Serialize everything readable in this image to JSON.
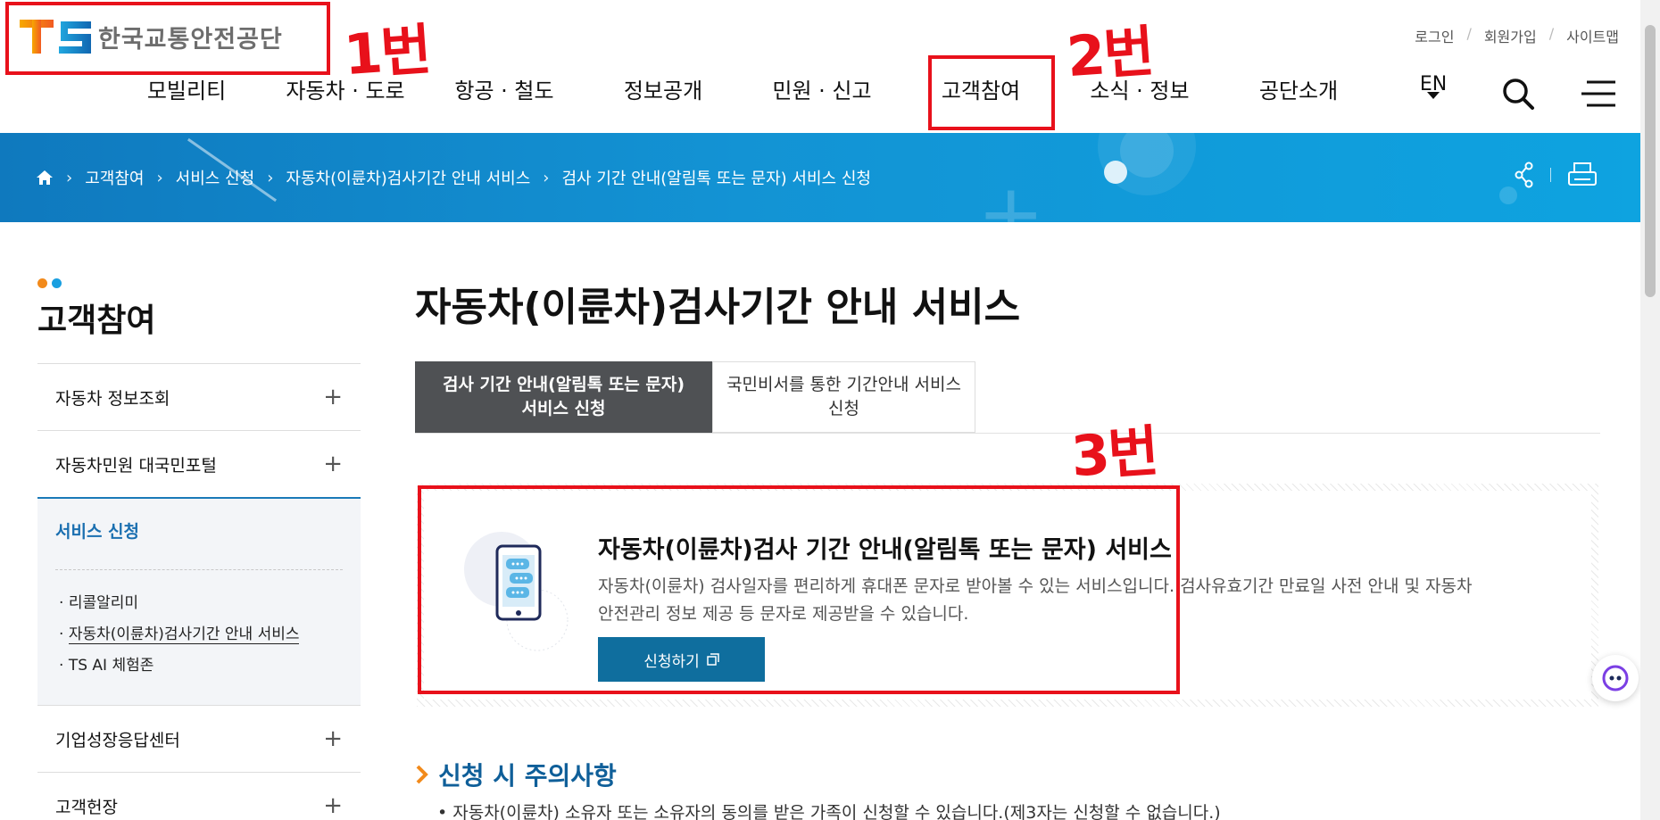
{
  "header": {
    "logo_letters": "TS",
    "logo_text": "한국교통안전공단",
    "util": [
      "로그인",
      "회원가입",
      "사이트맵"
    ],
    "gnb": [
      "모빌리티",
      "자동차 · 도로",
      "항공 · 철도",
      "정보공개",
      "민원 · 신고",
      "고객참여",
      "소식 · 정보",
      "공단소개"
    ],
    "lang": "EN"
  },
  "breadcrumb": [
    "고객참여",
    "서비스 신청",
    "자동차(이륜차)검사기간 안내 서비스",
    "검사 기간 안내(알림톡 또는 문자) 서비스 신청"
  ],
  "sidebar": {
    "title": "고객참여",
    "items": [
      {
        "label": "자동차 정보조회"
      },
      {
        "label": "자동차민원 대국민포털"
      },
      {
        "label": "서비스 신청"
      },
      {
        "label": "기업성장응답센터"
      },
      {
        "label": "고객헌장"
      }
    ],
    "sub_items": [
      "리콜알리미",
      "자동차(이륜차)검사기간 안내 서비스",
      "TS AI 체험존"
    ],
    "sub_bullet": "·"
  },
  "content": {
    "title": "자동차(이륜차)검사기간 안내 서비스",
    "tabs": [
      {
        "line1": "검사 기간 안내(알림톡 또는 문자)",
        "line2": "서비스 신청"
      },
      {
        "line1": "국민비서를 통한 기간안내 서비스",
        "line2": "신청"
      }
    ],
    "service": {
      "title": "자동차(이륜차)검사 기간 안내(알림톡 또는 문자) 서비스",
      "desc_line1": "자동차(이륜차) 검사일자를 편리하게 휴대폰 문자로 받아볼 수 있는 서비스입니다. 검사유효기간 만료일 사전 안내 및 자동차",
      "desc_line2": "안전관리 정보 제공 등 문자로 제공받을 수 있습니다.",
      "button": "신청하기"
    },
    "notice_title": "신청 시 주의사항",
    "notice_line": "• 자동차(이륜차) 소유자 또는 소유자의 동의를 받은 가족이 신청할 수 있습니다.(제3자는 신청할 수 없습니다.)"
  },
  "annotations": [
    "1번",
    "2번",
    "3번"
  ],
  "colors": {
    "brand_blue": "#1393d4",
    "annotation_red": "#e8111b",
    "tab_active": "#4f5154",
    "button": "#0f6e9e"
  }
}
